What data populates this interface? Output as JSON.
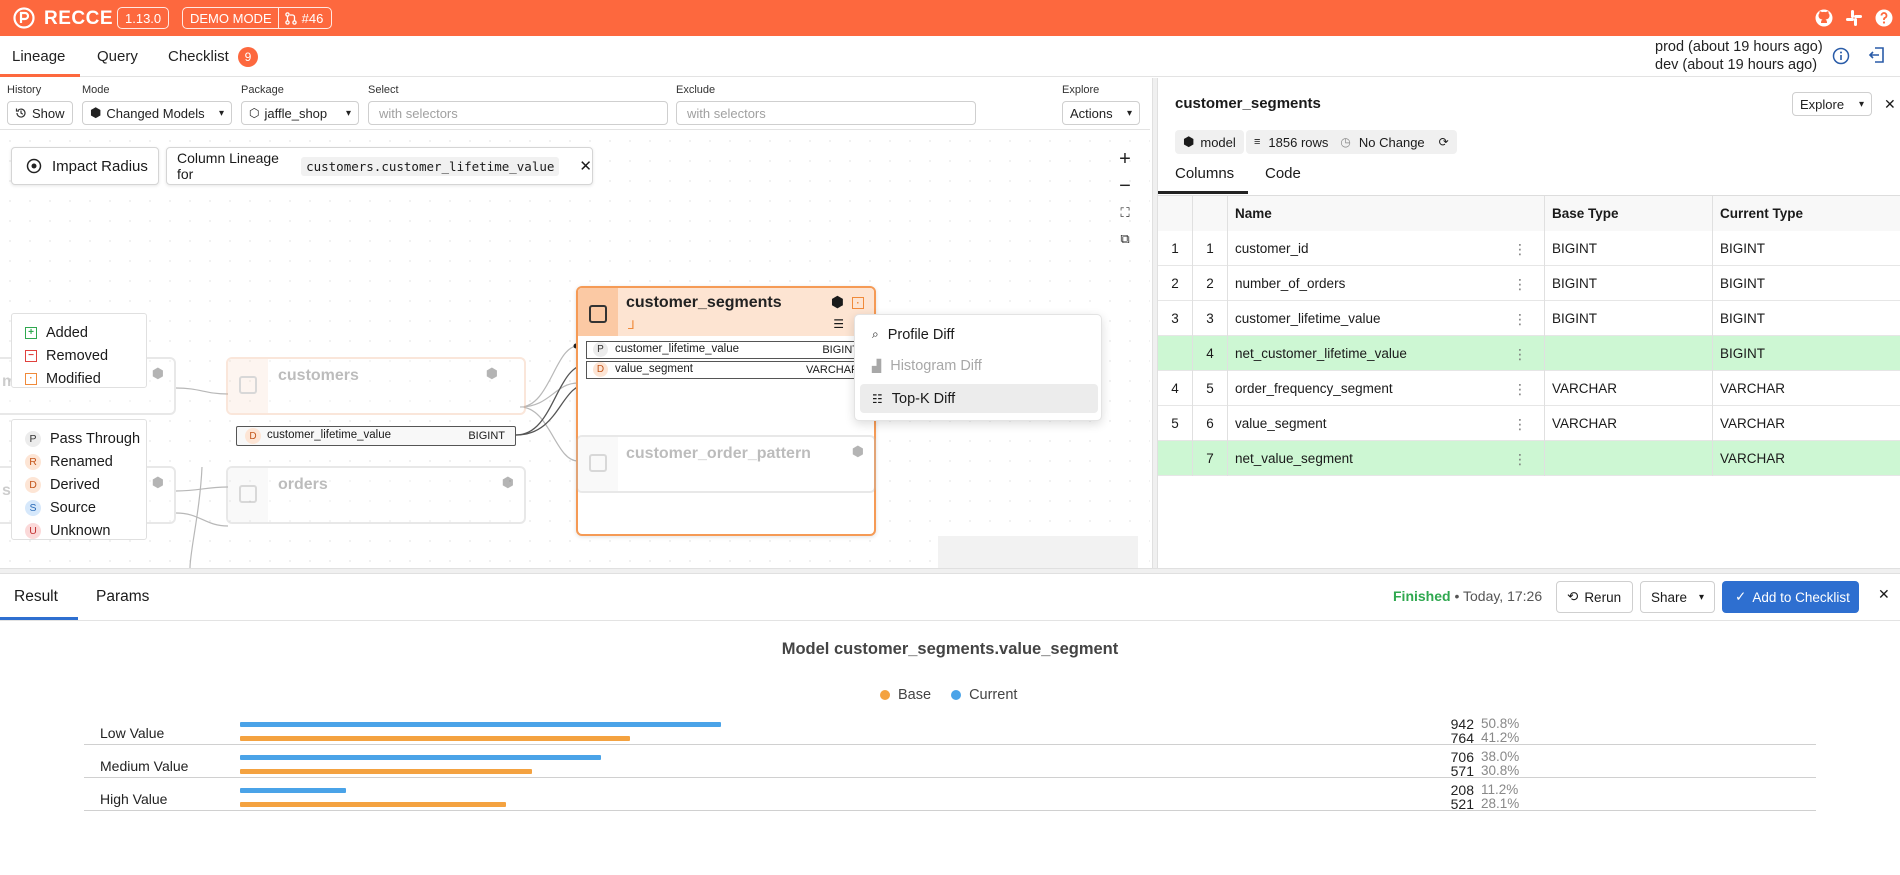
{
  "topbar": {
    "brand": "RECCE",
    "version": "1.13.0",
    "mode": "DEMO MODE",
    "pr": "#46",
    "accent": "#fd683e"
  },
  "nav": {
    "tabs": [
      "Lineage",
      "Query",
      "Checklist"
    ],
    "checklist_count": "9",
    "env_prod": "prod (about 19 hours ago)",
    "env_dev": "dev (about 19 hours ago)"
  },
  "controls": {
    "history_label": "History",
    "history_btn": "Show",
    "mode_label": "Mode",
    "mode_value": "Changed Models",
    "package_label": "Package",
    "package_value": "jaffle_shop",
    "select_label": "Select",
    "select_placeholder": "with selectors",
    "exclude_label": "Exclude",
    "exclude_placeholder": "with selectors",
    "explore_label": "Explore",
    "actions_btn": "Actions"
  },
  "canvas": {
    "impact_radius": "Impact Radius",
    "column_lineage_prefix": "Column Lineage for",
    "column_lineage_target": "customers.customer_lifetime_value",
    "legend_change": [
      {
        "symbol": "+",
        "label": "Added",
        "color": "#2fa84f"
      },
      {
        "symbol": "−",
        "label": "Removed",
        "color": "#e0413d"
      },
      {
        "symbol": "·",
        "label": "Modified",
        "color": "#f08a3a"
      }
    ],
    "legend_column": [
      {
        "letter": "P",
        "label": "Pass Through",
        "bg": "#ececec",
        "fg": "#333"
      },
      {
        "letter": "R",
        "label": "Renamed",
        "bg": "#fde5d5",
        "fg": "#c4551a"
      },
      {
        "letter": "D",
        "label": "Derived",
        "bg": "#fde5d5",
        "fg": "#c4551a"
      },
      {
        "letter": "S",
        "label": "Source",
        "bg": "#d6e8fb",
        "fg": "#2a6bb8"
      },
      {
        "letter": "U",
        "label": "Unknown",
        "bg": "#fbd9d9",
        "fg": "#c23232"
      }
    ],
    "nodes": {
      "customers": "customers",
      "customers_col_type": "D",
      "customers_col": "customer_lifetime_value",
      "customers_col_dtype": "BIGINT",
      "orders": "orders",
      "customer_segments": "customer_segments",
      "seg_col1_type": "P",
      "seg_col1": "customer_lifetime_value",
      "seg_col1_dtype": "BIGINT",
      "seg_col2_type": "D",
      "seg_col2": "value_segment",
      "seg_col2_dtype": "VARCHAR",
      "customer_order_pattern": "customer_order_pattern",
      "left_partial_1": "m",
      "left_partial_2": "s"
    },
    "context_menu": [
      "Profile Diff",
      "Histogram Diff",
      "Top-K Diff"
    ]
  },
  "right_panel": {
    "title": "customer_segments",
    "explore_btn": "Explore",
    "tag_model": "model",
    "tag_rows": "1856 rows",
    "tag_change": "No Change",
    "tabs": [
      "Columns",
      "Code"
    ],
    "headers": [
      "Name",
      "Base Type",
      "Current Type"
    ],
    "rows": [
      {
        "base_idx": "1",
        "cur_idx": "1",
        "name": "customer_id",
        "base_type": "BIGINT",
        "current_type": "BIGINT",
        "added": false
      },
      {
        "base_idx": "2",
        "cur_idx": "2",
        "name": "number_of_orders",
        "base_type": "BIGINT",
        "current_type": "BIGINT",
        "added": false
      },
      {
        "base_idx": "3",
        "cur_idx": "3",
        "name": "customer_lifetime_value",
        "base_type": "BIGINT",
        "current_type": "BIGINT",
        "added": false
      },
      {
        "base_idx": "",
        "cur_idx": "4",
        "name": "net_customer_lifetime_value",
        "base_type": "",
        "current_type": "BIGINT",
        "added": true
      },
      {
        "base_idx": "4",
        "cur_idx": "5",
        "name": "order_frequency_segment",
        "base_type": "VARCHAR",
        "current_type": "VARCHAR",
        "added": false
      },
      {
        "base_idx": "5",
        "cur_idx": "6",
        "name": "value_segment",
        "base_type": "VARCHAR",
        "current_type": "VARCHAR",
        "added": false
      },
      {
        "base_idx": "",
        "cur_idx": "7",
        "name": "net_value_segment",
        "base_type": "",
        "current_type": "VARCHAR",
        "added": true
      }
    ]
  },
  "bottom": {
    "tabs": [
      "Result",
      "Params"
    ],
    "status": "Finished",
    "status_time": "• Today, 17:26",
    "rerun": "Rerun",
    "share": "Share",
    "add_to_checklist": "Add to Checklist"
  },
  "chart_data": {
    "type": "bar",
    "title": "Model customer_segments.value_segment",
    "categories": [
      "Low Value",
      "Medium Value",
      "High Value"
    ],
    "series": [
      {
        "name": "Current",
        "color": "#4aa3e8",
        "values": [
          942,
          706,
          208
        ],
        "labels": [
          "50.8%",
          "38.0%",
          "11.2%"
        ]
      },
      {
        "name": "Base",
        "color": "#f4a240",
        "values": [
          764,
          571,
          521
        ],
        "labels": [
          "41.2%",
          "30.8%",
          "28.1%"
        ]
      }
    ],
    "legend_order": [
      "Base",
      "Current"
    ],
    "xmax": 1855
  }
}
